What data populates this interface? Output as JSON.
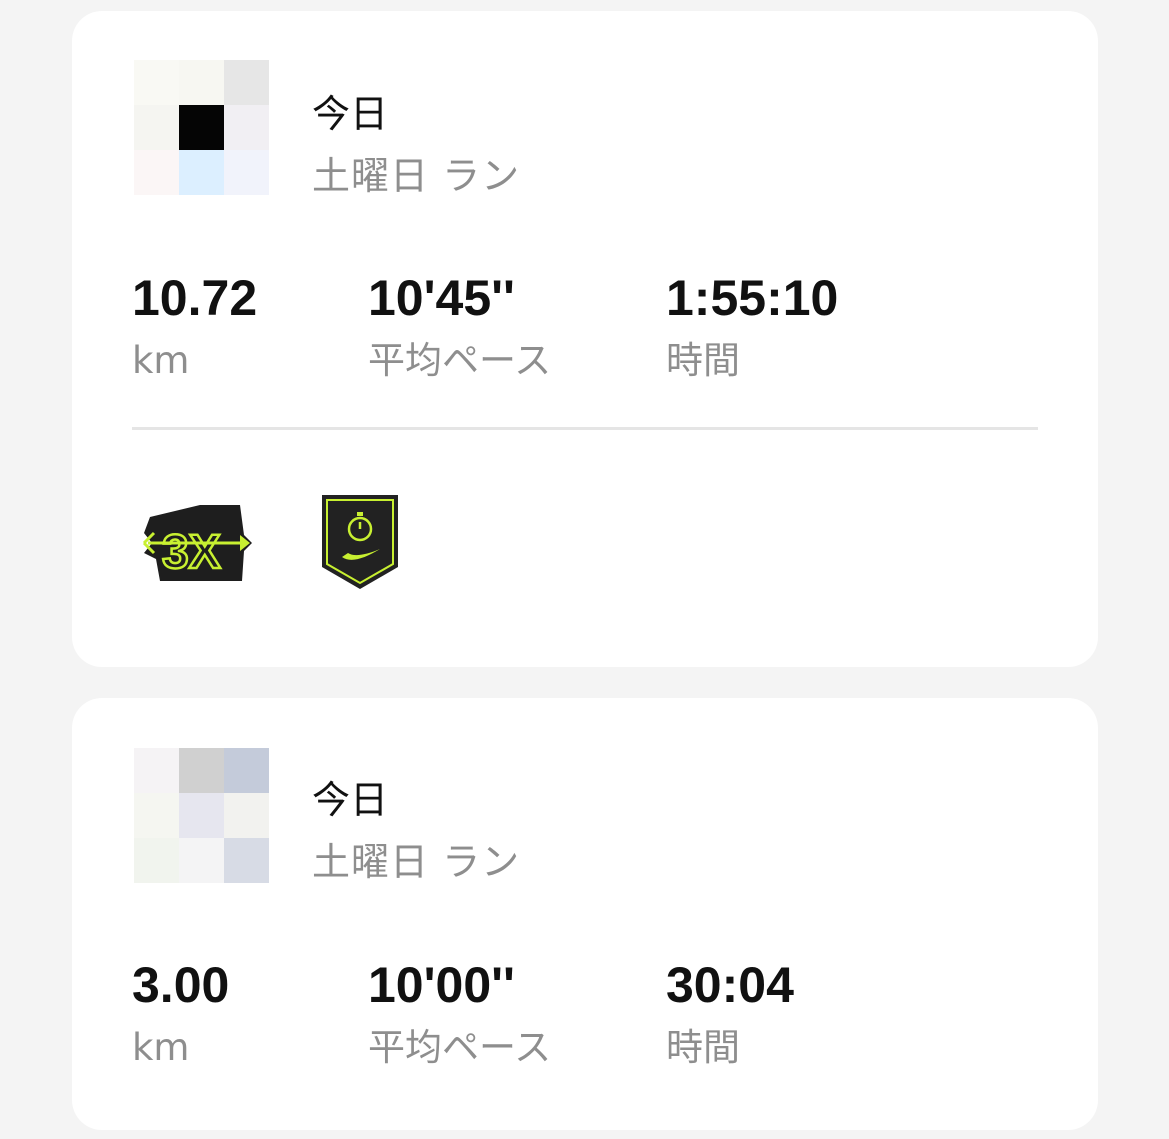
{
  "activities": [
    {
      "date_label": "今日",
      "title": "土曜日 ラン",
      "distance": "10.72",
      "distance_unit": "km",
      "pace": "10'45''",
      "pace_label": "平均ペース",
      "duration": "1:55:10",
      "duration_label": "時間",
      "badges": [
        "3x-streak-badge-icon",
        "stopwatch-shield-badge-icon"
      ]
    },
    {
      "date_label": "今日",
      "title": "土曜日 ラン",
      "distance": "3.00",
      "distance_unit": "km",
      "pace": "10'00''",
      "pace_label": "平均ペース",
      "duration": "30:04",
      "duration_label": "時間"
    }
  ],
  "colors": {
    "background": "#f4f4f4",
    "card": "#ffffff",
    "primary_text": "#111111",
    "secondary_text": "#8e8e8e",
    "badge_accent": "#c8f031",
    "badge_dark": "#222222"
  }
}
